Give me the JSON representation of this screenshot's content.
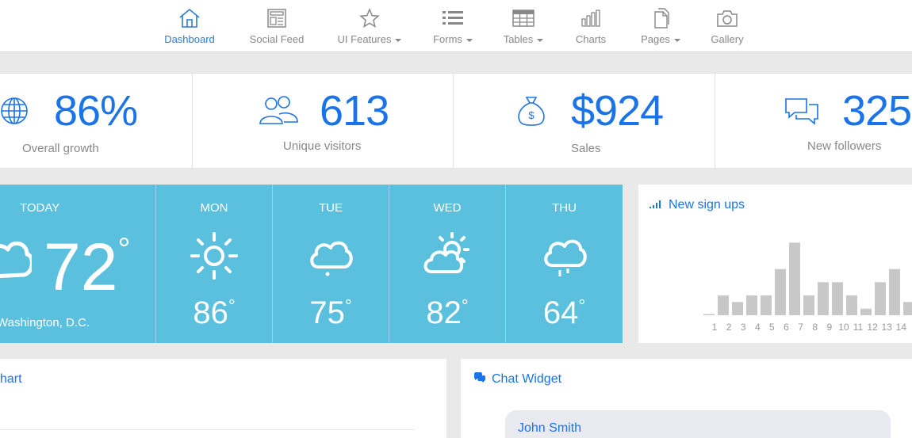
{
  "nav": {
    "items": [
      {
        "label": "Dashboard",
        "icon": "home-icon",
        "active": true
      },
      {
        "label": "Social Feed",
        "icon": "feed-icon"
      },
      {
        "label": "UI Features",
        "icon": "star-icon",
        "dropdown": true
      },
      {
        "label": "Forms",
        "icon": "list-icon",
        "dropdown": true
      },
      {
        "label": "Tables",
        "icon": "table-icon",
        "dropdown": true
      },
      {
        "label": "Charts",
        "icon": "bar-chart-icon"
      },
      {
        "label": "Pages",
        "icon": "pages-icon",
        "dropdown": true
      },
      {
        "label": "Gallery",
        "icon": "camera-icon"
      }
    ]
  },
  "stats": [
    {
      "value": "86%",
      "label": "Overall growth",
      "icon": "globe-icon"
    },
    {
      "value": "613",
      "label": "Unique visitors",
      "icon": "users-icon"
    },
    {
      "value": "$924",
      "label": "Sales",
      "icon": "money-bag-icon"
    },
    {
      "value": "325",
      "label": "New followers",
      "icon": "chat-bubbles-icon"
    }
  ],
  "weather": {
    "today": {
      "day": "TODAY",
      "temp": "72",
      "city": "Washington, D.C.",
      "icon": "cloud-icon"
    },
    "forecast": [
      {
        "day": "MON",
        "temp": "86",
        "icon": "sun-icon"
      },
      {
        "day": "TUE",
        "temp": "75",
        "icon": "cloud-icon"
      },
      {
        "day": "WED",
        "temp": "82",
        "icon": "partly-cloudy-icon"
      },
      {
        "day": "THU",
        "temp": "64",
        "icon": "rain-cloud-icon"
      }
    ],
    "degree_symbol": "°"
  },
  "signups": {
    "title": "New sign ups",
    "icon": "signal-icon",
    "chart_data": {
      "type": "bar",
      "categories": [
        "1",
        "2",
        "3",
        "4",
        "5",
        "6",
        "7",
        "8",
        "9",
        "10",
        "11",
        "12",
        "13",
        "14"
      ],
      "values": [
        0,
        3,
        2,
        3,
        3,
        7,
        11,
        3,
        5,
        5,
        3,
        1,
        5,
        7,
        2
      ],
      "ylim": [
        0,
        12
      ]
    }
  },
  "chart_panel": {
    "title": "hart"
  },
  "chat_panel": {
    "title": "Chat Widget",
    "icon": "comments-icon",
    "first_message_author": "John Smith"
  },
  "colors": {
    "accent": "#1a73e8",
    "weather_bg": "#5bc0de",
    "bar": "#c8c8c8"
  }
}
